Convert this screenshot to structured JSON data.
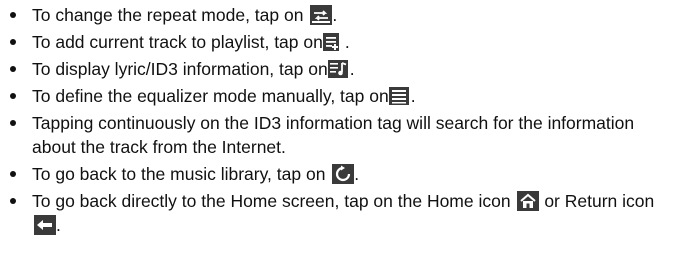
{
  "instructions": [
    {
      "text": "To change the repeat mode, tap on ",
      "icon": "repeat-mode-icon",
      "suffix": "."
    },
    {
      "text": "To add current track to playlist, tap on",
      "icon": "add-to-playlist-icon",
      "suffix": "."
    },
    {
      "text": "To display lyric/ID3 information, tap on",
      "icon": "lyric-id3-icon",
      "suffix": "."
    },
    {
      "text": "To define the equalizer mode manually, tap on",
      "icon": "equalizer-icon",
      "suffix": "."
    },
    {
      "text": "Tapping continuously on the ID3 information tag will search for the information about the track from the Internet."
    },
    {
      "text": "To go back to the music library, tap on ",
      "icon": "music-library-icon",
      "suffix": "."
    },
    {
      "text": "To go back directly to the Home screen, tap on the Home icon ",
      "icon": "home-icon",
      "middle": " or Return icon ",
      "icon2": "return-icon",
      "suffix": "."
    }
  ],
  "colors": {
    "text": "#111111",
    "icon_dark": "#3a3a3a",
    "icon_light": "#ffffff"
  }
}
